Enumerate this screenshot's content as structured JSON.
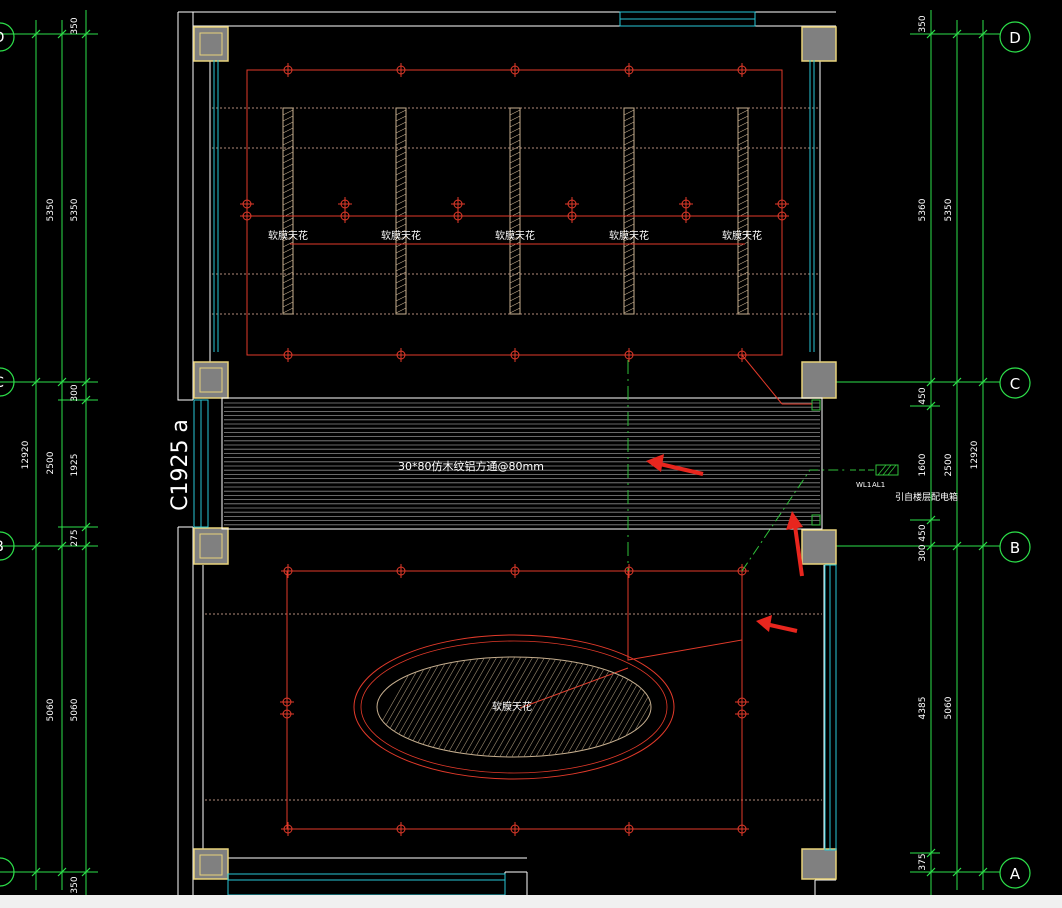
{
  "colors": {
    "background": "#000000",
    "wall": "#ffffff",
    "column_fill": "#808080",
    "column_edge": "#e8d27a",
    "lighting": "#e23a2a",
    "axis": "#2de04a",
    "window": "#27c6d6",
    "strip": "#c8b090",
    "arrow": "#e8261e",
    "circuit": "#2fbf3a",
    "statusbar": "#f0f0f0"
  },
  "axes": {
    "D": "D",
    "C": "C",
    "B": "B",
    "A": "A"
  },
  "dimensions": {
    "left": {
      "outer_350_top": "350",
      "outer_5350_a": "5350",
      "outer_5350_b": "5350",
      "outer_300": "300",
      "outer_12920": "12920",
      "outer_2500": "2500",
      "outer_1925": "1925",
      "outer_275": "275",
      "outer_5060_a": "5060",
      "outer_5060_b": "5060",
      "outer_350_bottom": "350"
    },
    "right": {
      "r_350": "350",
      "r_5360": "5360",
      "r_5350": "5350",
      "r_450_top": "450",
      "r_1600": "1600",
      "r_2500": "2500",
      "r_12920": "12920",
      "r_450_bottom": "450",
      "r_300": "300",
      "r_4385": "4385",
      "r_5060": "5060",
      "r_375": "375"
    }
  },
  "labels": {
    "window_tag": "C1925 a",
    "ceiling_label": "软膜天花",
    "ceiling_upper": [
      "软膜天花",
      "软膜天花",
      "软膜天花",
      "软膜天花",
      "软膜天花"
    ],
    "ceiling_lower": "软膜天花",
    "grille_note": "30*80仿木纹铝方通@80mm",
    "panel_note": "引自楼层配电箱",
    "circuit_tag_1": "WL1",
    "circuit_tag_2": "AL1"
  }
}
